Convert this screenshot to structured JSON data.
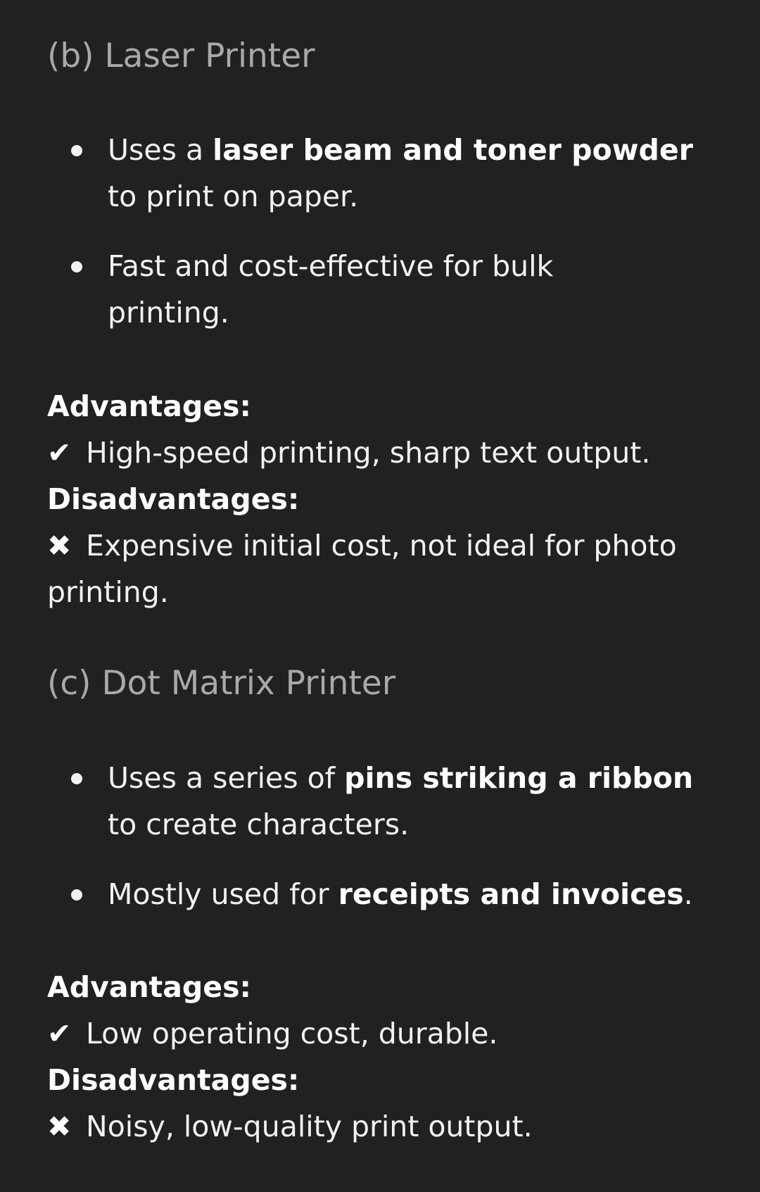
{
  "sections": [
    {
      "heading": "(b) Laser Printer",
      "bullets": [
        {
          "parts": [
            {
              "text": "Uses a ",
              "bold": false
            },
            {
              "text": "laser beam and toner powder",
              "bold": true
            },
            {
              "text": " to print on paper.",
              "bold": false
            }
          ]
        },
        {
          "parts": [
            {
              "text": "Fast and cost-effective for bulk printing.",
              "bold": false
            }
          ]
        }
      ],
      "advantages_label": "Advantages:",
      "advantage_mark": "✔",
      "advantage_text": "High-speed printing, sharp text output.",
      "disadvantages_label": "Disadvantages:",
      "disadvantage_mark": "✖",
      "disadvantage_text": "Expensive initial cost, not ideal for photo printing."
    },
    {
      "heading": "(c) Dot Matrix Printer",
      "bullets": [
        {
          "parts": [
            {
              "text": "Uses a series of ",
              "bold": false
            },
            {
              "text": "pins striking a ribbon",
              "bold": true
            },
            {
              "text": " to create characters.",
              "bold": false
            }
          ]
        },
        {
          "parts": [
            {
              "text": "Mostly used for ",
              "bold": false
            },
            {
              "text": "receipts and invoices",
              "bold": true
            },
            {
              "text": ".",
              "bold": false
            }
          ]
        }
      ],
      "advantages_label": "Advantages:",
      "advantage_mark": "✔",
      "advantage_text": "Low operating cost, durable.",
      "disadvantages_label": "Disadvantages:",
      "disadvantage_mark": "✖",
      "disadvantage_text": "Noisy, low-quality print output."
    }
  ]
}
